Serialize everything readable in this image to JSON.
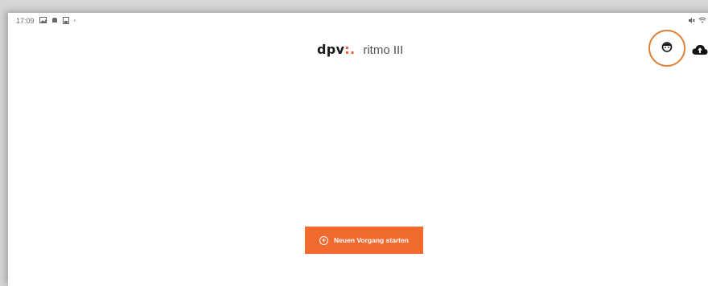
{
  "statusbar": {
    "time": "17:09",
    "icons_left": [
      "image-icon",
      "notification-icon",
      "save-icon",
      "dot-icon"
    ],
    "icons_right": [
      "mute-icon",
      "wifi-icon"
    ]
  },
  "header": {
    "brand_name": "dpv",
    "brand_mark": ":.",
    "app_name": "ritmo III",
    "icons": [
      "profile-icon",
      "cloud-upload-icon"
    ],
    "highlight_color": "#e0833a"
  },
  "main": {
    "start_button_label": "Neuen Vorgang starten",
    "start_button_color": "#f26a2e"
  }
}
